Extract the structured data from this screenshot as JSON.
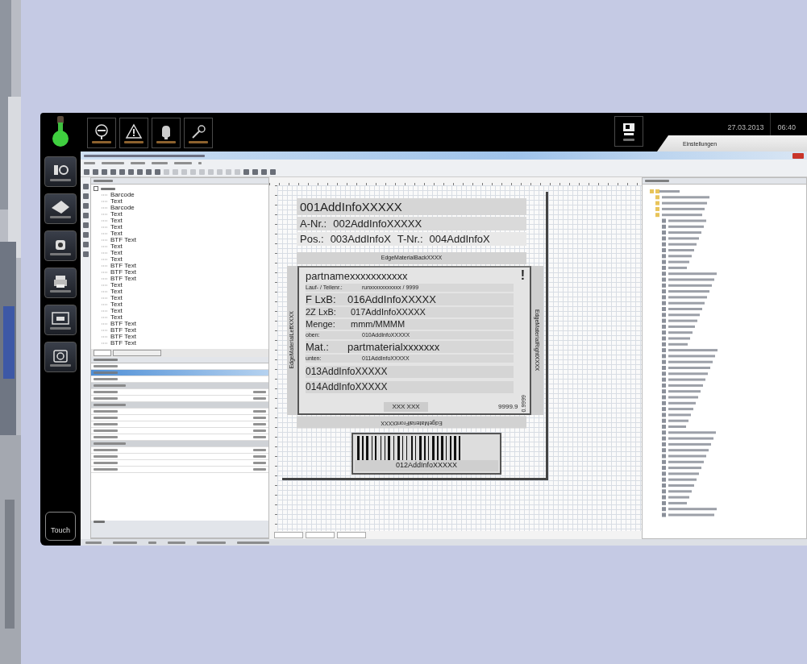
{
  "top_bar": {
    "date": "27.03.2013",
    "time": "06:40",
    "tab": "Einstellungen"
  },
  "sidebar": {
    "logo_text": "Touch"
  },
  "layout_tree": {
    "items": [
      "Barcode",
      "Text",
      "Barcode",
      "Text",
      "Text",
      "Text",
      "Text",
      "BTF Text",
      "Text",
      "Text",
      "Text",
      "BTF Text",
      "BTF Text",
      "BTF Text",
      "Text",
      "Text",
      "Text",
      "Text",
      "Text",
      "Text",
      "BTF Text",
      "BTF Text",
      "BTF Text",
      "BTF Text"
    ]
  },
  "label": {
    "title": "001AddInfoXXXXX",
    "order_line": {
      "label": "A-Nr.:",
      "value": "002AddInfoXXXXX"
    },
    "position_line": [
      {
        "label": "Pos.:",
        "value": "003AddInfoX"
      },
      {
        "label": "T-Nr.:",
        "value": "004AddInfoX"
      }
    ],
    "edge_back": "EdgeMaterialBackXXXX",
    "edge_left": "EdgeMaterialLeftXXXX",
    "edge_right": "EdgeMaterialRightXXXX",
    "edge_front": "EdgeMaterialFrontXXXX",
    "part_name": "partnamexxxxxxxxxxx",
    "warning_mark": "!",
    "rows": [
      {
        "kind": "small",
        "label": "Lauf- / Teilenr.:",
        "value": "runxxxxxxxxxxx / 9999"
      },
      {
        "kind": "large",
        "label": "F LxB:",
        "value": "016AddInfoXXXXX"
      },
      {
        "kind": "medium",
        "label": "2Z LxB:",
        "value": "017AddInfoXXXXX"
      },
      {
        "kind": "medium",
        "label": "Menge:",
        "value": "mmm/MMMM"
      },
      {
        "kind": "small",
        "label": "oben:",
        "value": "010AddInfoXXXXX"
      },
      {
        "kind": "large",
        "label": "Mat.:",
        "value": "partmaterialxxxxxxx"
      },
      {
        "kind": "small",
        "label": "unten:",
        "value": "011AddInfoXXXXX"
      }
    ],
    "extra_lines": [
      "013AddInfoXXXXX",
      "014AddInfoXXXXX"
    ],
    "code": "XXX XXX",
    "measure": "9999.9",
    "side_measure": "0.9999",
    "barcode_text": "012AddInfoXXXXX"
  }
}
